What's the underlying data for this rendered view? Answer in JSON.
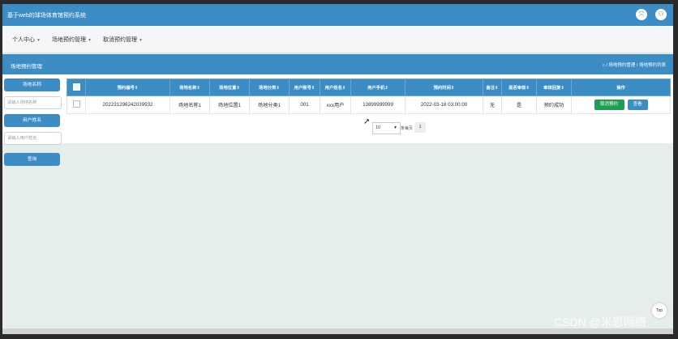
{
  "app": {
    "title": "基于web的球场体育馆预约系统",
    "buttons": [
      "⤧",
      "⚇"
    ]
  },
  "menu": {
    "items": [
      {
        "label": "个人中心"
      },
      {
        "label": "场地预约管理"
      },
      {
        "label": "取消预约管理"
      }
    ]
  },
  "subheader": {
    "title": "场地预约管理",
    "breadcrumb": "⌂ / 场地预约管理 / 场地预约列表"
  },
  "sidebar": {
    "venue_name_btn": "场地名称",
    "venue_name_placeholder": "请输入场地名称",
    "user_name_btn": "用户姓名",
    "user_name_placeholder": "请输入用户姓名",
    "query_btn": "查询"
  },
  "table": {
    "headers": [
      "预约编号⇕",
      "场地名称⇕",
      "场地位置⇕",
      "场地分类⇕",
      "用户账号⇕",
      "用户姓名⇕",
      "用户手机⇕",
      "预约时间⇕",
      "备注⇕",
      "是否审核⇕",
      "审核回复⇕",
      "操作"
    ],
    "rows": [
      {
        "cells": [
          "202231296242039932",
          "场地名称1",
          "场地位置1",
          "场地分类1",
          "001",
          "xxx用户",
          "13899999999",
          "2022-03-16 03:00:00",
          "无",
          "是",
          "预约成功"
        ],
        "cancel_label": "取消预约",
        "view_label": "查看"
      }
    ]
  },
  "pager": {
    "page_size": "10",
    "total_text": "条每页",
    "current_page": "1"
  },
  "top_button": "Top",
  "watermark": "CSDN @米恩网络"
}
